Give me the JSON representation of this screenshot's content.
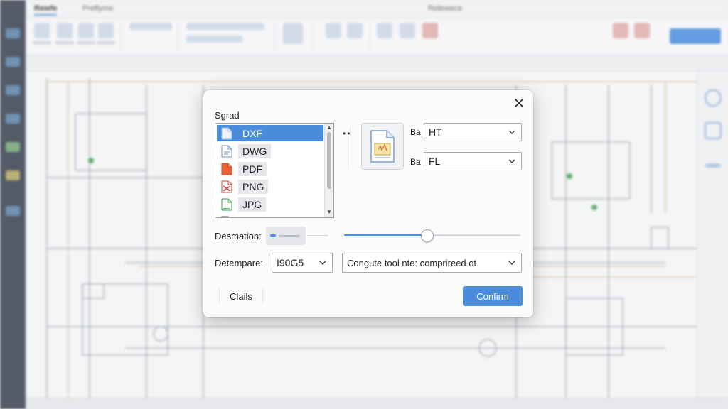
{
  "app": {
    "tabs": [
      "Rewfe",
      "Preflyme",
      "Relewece"
    ]
  },
  "dialog": {
    "title": "Sgrad",
    "formats": [
      {
        "label": "DXF",
        "icon": "dxf-file-icon",
        "selected": true
      },
      {
        "label": "DWG",
        "icon": "dwg-file-icon",
        "selected": false
      },
      {
        "label": "PDF",
        "icon": "pdf-file-icon",
        "selected": false
      },
      {
        "label": "PNG",
        "icon": "png-file-icon",
        "selected": false
      },
      {
        "label": "JPG",
        "icon": "jpg-file-icon",
        "selected": false
      }
    ],
    "more_indicator": "••",
    "prop1": {
      "label": "Ba",
      "value": "HT"
    },
    "prop2": {
      "label": "Ba",
      "value": "FL"
    },
    "destination": {
      "label": "Desmation:",
      "slider_value": 0.47
    },
    "datetemplate": {
      "label": "Detempare:",
      "value": "I90G5"
    },
    "compression": {
      "value": "Congute tool nte: comprireed ot"
    },
    "cancel_label": "Clails",
    "confirm_label": "Confirm"
  },
  "colors": {
    "accent": "#4a8bdc",
    "selection": "#4a8bdc"
  }
}
